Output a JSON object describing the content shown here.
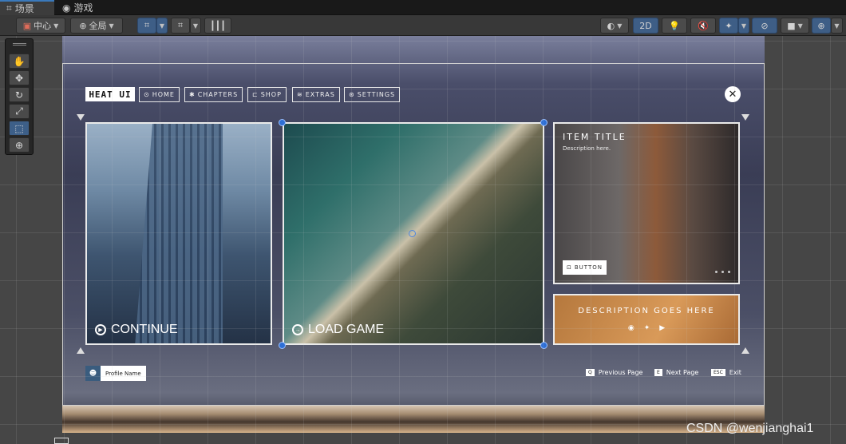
{
  "tabs": [
    {
      "label": "场景",
      "icon": "grid-icon"
    },
    {
      "label": "游戏",
      "icon": "gamepad-icon"
    }
  ],
  "toolbar": {
    "pivot": "中心",
    "space": "全局",
    "mode_2d": "2D"
  },
  "scene_ui": {
    "logo": "HEAT UI",
    "nav": [
      {
        "label": "HOME",
        "icon": "home-icon"
      },
      {
        "label": "CHAPTERS",
        "icon": "chapters-icon"
      },
      {
        "label": "SHOP",
        "icon": "cart-icon"
      },
      {
        "label": "EXTRAS",
        "icon": "extras-icon"
      },
      {
        "label": "SETTINGS",
        "icon": "settings-icon"
      }
    ],
    "close": "✕",
    "continue_label": "CONTINUE",
    "load_label": "LOAD GAME",
    "item_title": "ITEM TITLE",
    "item_desc": "Description here.",
    "item_button": "BUTTON",
    "desc_text": "DESCRIPTION GOES HERE",
    "socials": [
      "discord-icon",
      "twitter-icon",
      "youtube-icon"
    ],
    "profile_name": "Profile Name",
    "hints": [
      {
        "key": "Q",
        "label": "Previous Page"
      },
      {
        "key": "E",
        "label": "Next Page"
      },
      {
        "key": "ESC",
        "label": "Exit"
      }
    ]
  },
  "watermark": "CSDN @wenjianghai1",
  "colors": {
    "accent": "#3a79bb",
    "selection": "#2e6fd6",
    "desc_panel": "#c98a4b"
  }
}
